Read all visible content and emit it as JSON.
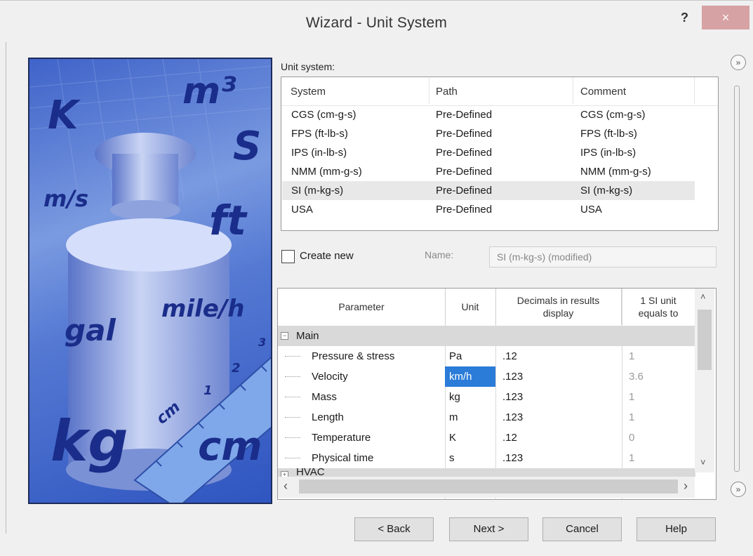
{
  "window": {
    "title": "Wizard - Unit System",
    "help": "?",
    "close": "×"
  },
  "image": {
    "words": [
      "K",
      "m³",
      "S",
      "m/s",
      "ft",
      "gal",
      "mile/h",
      "kg",
      "cm",
      "cm"
    ],
    "ruler_numbers": [
      "1",
      "2",
      "3"
    ]
  },
  "unit_system": {
    "label": "Unit system:",
    "columns": [
      "System",
      "Path",
      "Comment"
    ],
    "rows": [
      {
        "system": "CGS (cm-g-s)",
        "path": "Pre-Defined",
        "comment": "CGS (cm-g-s)"
      },
      {
        "system": "FPS (ft-lb-s)",
        "path": "Pre-Defined",
        "comment": "FPS (ft-lb-s)"
      },
      {
        "system": "IPS (in-lb-s)",
        "path": "Pre-Defined",
        "comment": "IPS (in-lb-s)"
      },
      {
        "system": "NMM (mm-g-s)",
        "path": "Pre-Defined",
        "comment": "NMM (mm-g-s)"
      },
      {
        "system": "SI (m-kg-s)",
        "path": "Pre-Defined",
        "comment": "SI (m-kg-s)"
      },
      {
        "system": "USA",
        "path": "Pre-Defined",
        "comment": "USA"
      }
    ],
    "selected_index": 4
  },
  "create_new": {
    "label": "Create new",
    "checked": false
  },
  "name_field": {
    "label": "Name:",
    "value": "SI (m-kg-s) (modified)"
  },
  "params": {
    "columns": [
      "Parameter",
      "Unit",
      "Decimals in results display",
      "1 SI unit equals to"
    ],
    "groups": [
      {
        "name": "Main",
        "expander": "−"
      },
      {
        "name": "HVAC",
        "expander": "+"
      }
    ],
    "rows": [
      {
        "parameter": "Pressure & stress",
        "unit": "Pa",
        "decimals": ".12",
        "equals": "1"
      },
      {
        "parameter": "Velocity",
        "unit": "km/h",
        "decimals": ".123",
        "equals": "3.6"
      },
      {
        "parameter": "Mass",
        "unit": "kg",
        "decimals": ".123",
        "equals": "1"
      },
      {
        "parameter": "Length",
        "unit": "m",
        "decimals": ".123",
        "equals": "1"
      },
      {
        "parameter": "Temperature",
        "unit": "K",
        "decimals": ".12",
        "equals": "0"
      },
      {
        "parameter": "Physical time",
        "unit": "s",
        "decimals": ".123",
        "equals": "1"
      }
    ],
    "selected_cell": {
      "row": 1,
      "column": "unit"
    }
  },
  "side": {
    "expand": "»"
  },
  "buttons": {
    "back": "< Back",
    "next": "Next >",
    "cancel": "Cancel",
    "help": "Help"
  },
  "colors": {
    "selection": "#2b7bd8",
    "close": "#d7a2a3"
  }
}
